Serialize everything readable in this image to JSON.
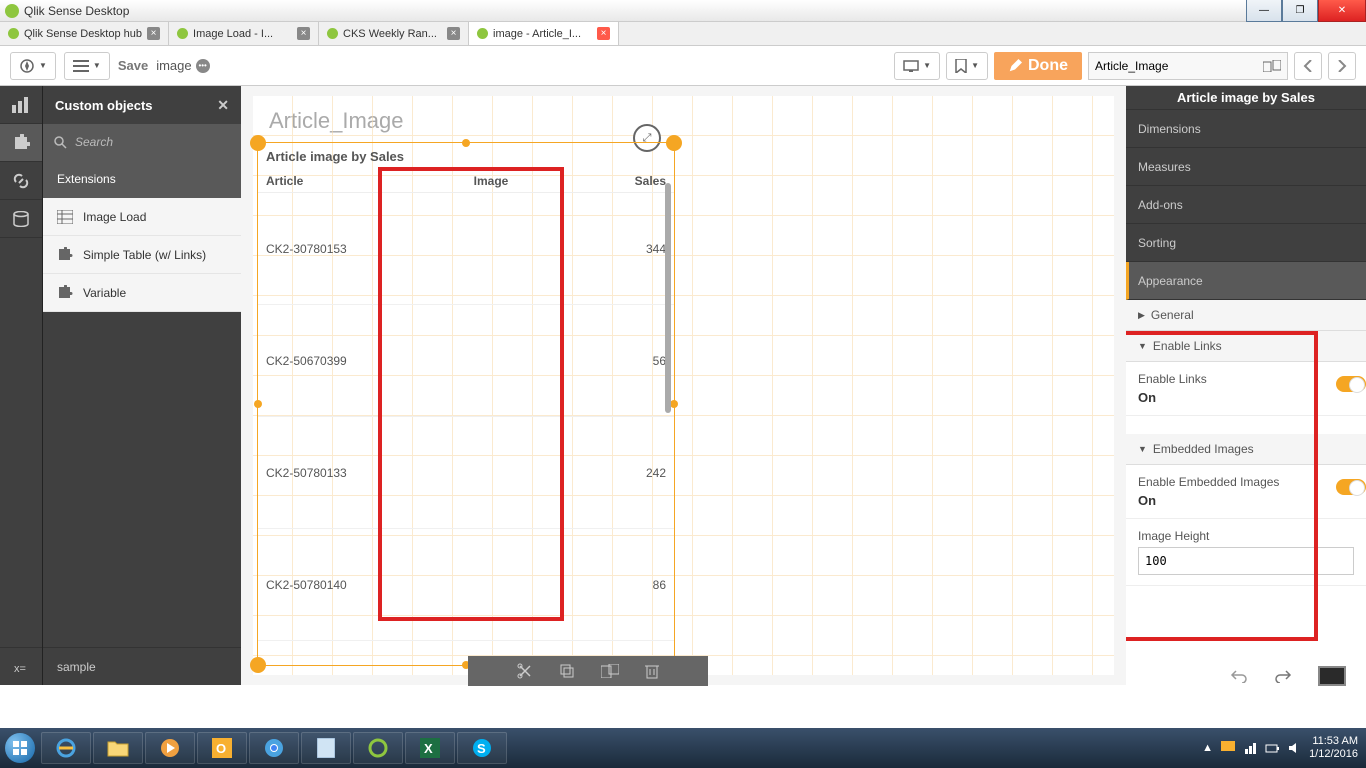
{
  "window": {
    "title": "Qlik Sense Desktop"
  },
  "browser_tabs": [
    {
      "label": "Qlik Sense Desktop hub",
      "active": false
    },
    {
      "label": "Image Load - I...",
      "active": false
    },
    {
      "label": "CKS Weekly Ran...",
      "active": false
    },
    {
      "label": "image - Article_I...",
      "active": true
    }
  ],
  "toolbar": {
    "save": "Save",
    "sheet_name": "image",
    "done": "Done",
    "object_name": "Article_Image"
  },
  "side": {
    "header": "Custom objects",
    "search_placeholder": "Search",
    "section": "Extensions",
    "items": [
      "Image Load",
      "Simple Table (w/ Links)",
      "Variable"
    ],
    "bottom": "sample"
  },
  "sheet": {
    "title": "Article_Image",
    "chart": {
      "title": "Article image by Sales",
      "columns": [
        "Article",
        "Image",
        "Sales"
      ],
      "rows": [
        {
          "article": "CK2-30780153",
          "sales": "344"
        },
        {
          "article": "CK2-50670399",
          "sales": "56"
        },
        {
          "article": "CK2-50780133",
          "sales": "242"
        },
        {
          "article": "CK2-50780140",
          "sales": "86"
        }
      ]
    }
  },
  "props": {
    "header": "Article image by Sales",
    "sections": [
      "Dimensions",
      "Measures",
      "Add-ons",
      "Sorting",
      "Appearance"
    ],
    "appearance": {
      "general": "General",
      "enable_links_hdr": "Enable Links",
      "enable_links_lbl": "Enable Links",
      "enable_links_val": "On",
      "embedded_hdr": "Embedded Images",
      "embedded_lbl": "Enable Embedded Images",
      "embedded_val": "On",
      "height_lbl": "Image Height",
      "height_val": "100"
    }
  },
  "tray": {
    "time": "11:53 AM",
    "date": "1/12/2016"
  }
}
